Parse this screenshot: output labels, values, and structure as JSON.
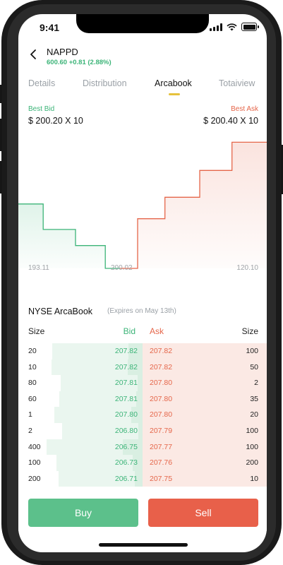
{
  "status": {
    "time": "9:41"
  },
  "header": {
    "ticker": "NAPPD",
    "price_change": "600.60  +0.81 (2.88%)"
  },
  "tabs": [
    {
      "label": "Details"
    },
    {
      "label": "Distribution"
    },
    {
      "label": "Arcabook",
      "active": true
    },
    {
      "label": "Totaiview"
    }
  ],
  "quote": {
    "best_bid_label": "Best Bid",
    "best_bid_value": "$ 200.20 X 10",
    "best_ask_label": "Best Ask",
    "best_ask_value": "$ 200.40 X 10"
  },
  "chart_data": {
    "type": "area",
    "x_tick_labels": [
      "193.11",
      "200.02",
      "120.10"
    ],
    "series": [
      {
        "points": [
          [
            0,
            0.52
          ],
          [
            0.1,
            0.52
          ],
          [
            0.1,
            0.71
          ],
          [
            0.23,
            0.71
          ],
          [
            0.23,
            0.83
          ],
          [
            0.35,
            0.83
          ],
          [
            0.35,
            1.0
          ],
          [
            0.41,
            1.0
          ]
        ],
        "color": "#3cb478"
      },
      {
        "points": [
          [
            0.41,
            1.0
          ],
          [
            0.48,
            1.0
          ],
          [
            0.48,
            0.63
          ],
          [
            0.59,
            0.63
          ],
          [
            0.59,
            0.47
          ],
          [
            0.73,
            0.47
          ],
          [
            0.73,
            0.27
          ],
          [
            0.86,
            0.27
          ],
          [
            0.86,
            0.06
          ],
          [
            1.0,
            0.06
          ]
        ],
        "color": "#e5664a"
      }
    ]
  },
  "book": {
    "title": "NYSE ArcaBook",
    "subtitle": "(Expires on May 13th)",
    "headers": {
      "size_left": "Size",
      "bid": "Bid",
      "ask": "Ask",
      "size_right": "Size"
    },
    "rows": [
      {
        "size_l": "20",
        "bid": "207.82",
        "ask": "207.82",
        "size_r": "100",
        "bid_depth": 0.28,
        "ask_depth": 1.0
      },
      {
        "size_l": "10",
        "bid": "207.82",
        "ask": "207.82",
        "size_r": "50",
        "bid_depth": 0.3,
        "ask_depth": 1.0
      },
      {
        "size_l": "80",
        "bid": "207.81",
        "ask": "207.80",
        "size_r": "2",
        "bid_depth": 0.1,
        "ask_depth": 1.0
      },
      {
        "size_l": "60",
        "bid": "207.81",
        "ask": "207.80",
        "size_r": "35",
        "bid_depth": 0.13,
        "ask_depth": 1.0
      },
      {
        "size_l": "1",
        "bid": "207.80",
        "ask": "207.80",
        "size_r": "20",
        "bid_depth": 0.23,
        "ask_depth": 1.0
      },
      {
        "size_l": "2",
        "bid": "206.80",
        "ask": "207.79",
        "size_r": "100",
        "bid_depth": 0.08,
        "ask_depth": 1.0
      },
      {
        "size_l": "400",
        "bid": "206.75",
        "ask": "207.77",
        "size_r": "100",
        "bid_depth": 0.4,
        "ask_depth": 1.0
      },
      {
        "size_l": "100",
        "bid": "206.73",
        "ask": "207.76",
        "size_r": "200",
        "bid_depth": 0.2,
        "ask_depth": 1.0
      },
      {
        "size_l": "200",
        "bid": "206.71",
        "ask": "207.75",
        "size_r": "10",
        "bid_depth": 0.15,
        "ask_depth": 1.0
      }
    ]
  },
  "actions": {
    "buy_label": "Buy",
    "sell_label": "Sell"
  },
  "colors": {
    "bid": "#3cb478",
    "ask": "#e5664a",
    "buy_button": "#5cc08b",
    "sell_button": "#e8604a",
    "tab_indicator": "#e6c23c"
  }
}
